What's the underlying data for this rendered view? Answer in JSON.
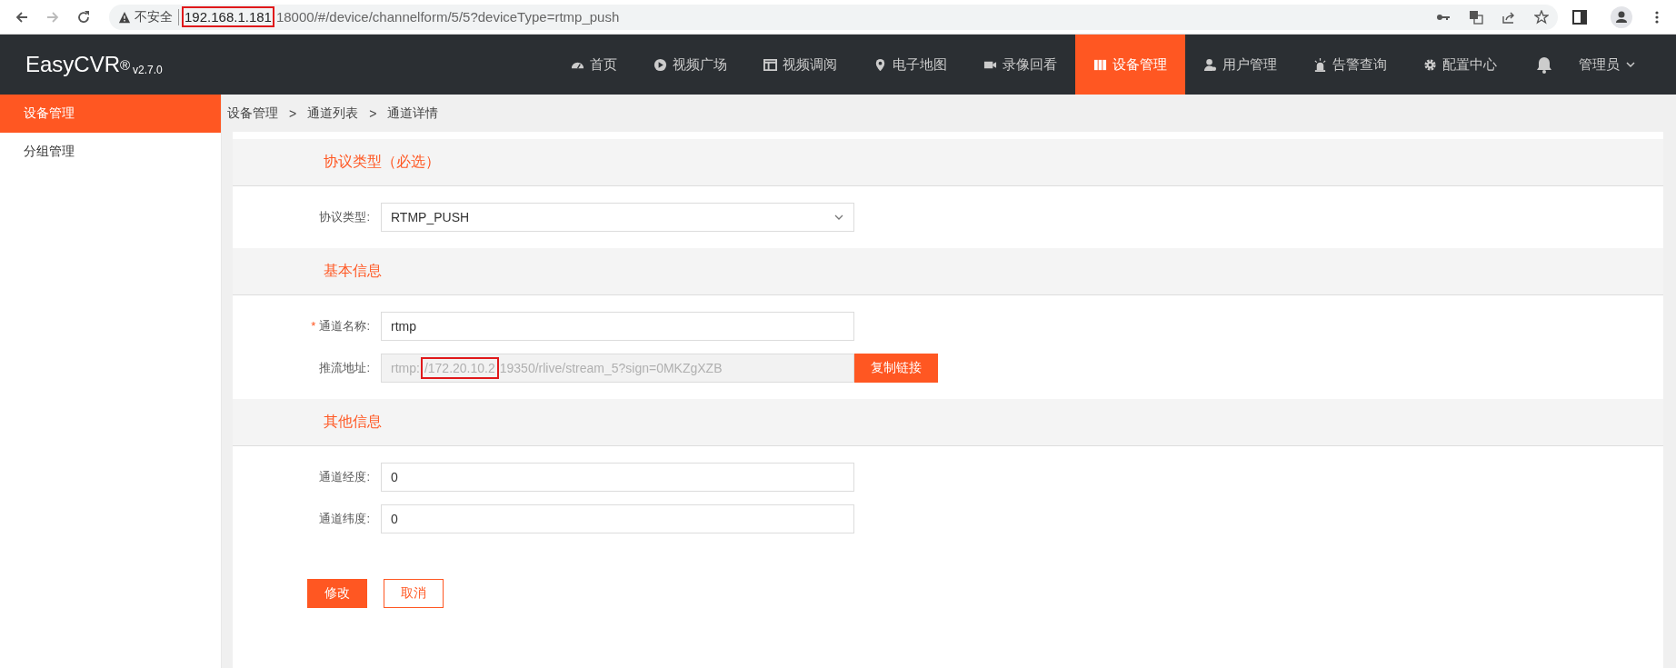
{
  "browser": {
    "security": "不安全",
    "url_highlight": "192.168.1.181",
    "url_rest": "18000/#/device/channelform/5/5?deviceType=rtmp_push"
  },
  "header": {
    "brand": "EasyCVR",
    "brand_mark": "®",
    "version": "v2.7.0",
    "user": "管理员"
  },
  "nav": [
    {
      "label": "首页",
      "selected": false
    },
    {
      "label": "视频广场",
      "selected": false
    },
    {
      "label": "视频调阅",
      "selected": false
    },
    {
      "label": "电子地图",
      "selected": false
    },
    {
      "label": "录像回看",
      "selected": false
    },
    {
      "label": "设备管理",
      "selected": true
    },
    {
      "label": "用户管理",
      "selected": false
    },
    {
      "label": "告警查询",
      "selected": false
    },
    {
      "label": "配置中心",
      "selected": false
    }
  ],
  "sidebar": {
    "items": [
      {
        "label": "设备管理",
        "selected": true
      },
      {
        "label": "分组管理",
        "selected": false
      }
    ]
  },
  "breadcrumb": [
    "设备管理",
    "通道列表",
    "通道详情"
  ],
  "breadcrumb_separator": ">",
  "sections": [
    {
      "title": "协议类型（必选）",
      "fields": [
        {
          "kind": "select",
          "label": "协议类型:",
          "value": "RTMP_PUSH",
          "required": false
        }
      ]
    },
    {
      "title": "基本信息",
      "fields": [
        {
          "kind": "text",
          "label": "通道名称:",
          "value": "rtmp",
          "required": true
        },
        {
          "kind": "copy",
          "label": "推流地址:",
          "value_before": "rtmp:",
          "value_highlight": "/172.20.10.2",
          "value_after": "19350/rlive/stream_5?sign=0MKZgXZB",
          "button": "复制链接",
          "disabled": true,
          "required": false
        }
      ]
    },
    {
      "title": "其他信息",
      "fields": [
        {
          "kind": "text",
          "label": "通道经度:",
          "value": "0",
          "required": false
        },
        {
          "kind": "text",
          "label": "通道纬度:",
          "value": "0",
          "required": false
        }
      ]
    }
  ],
  "required_mark": "*",
  "buttons": [
    {
      "label": "修改",
      "kind": "primary"
    },
    {
      "label": "取消",
      "kind": "secondary"
    }
  ]
}
